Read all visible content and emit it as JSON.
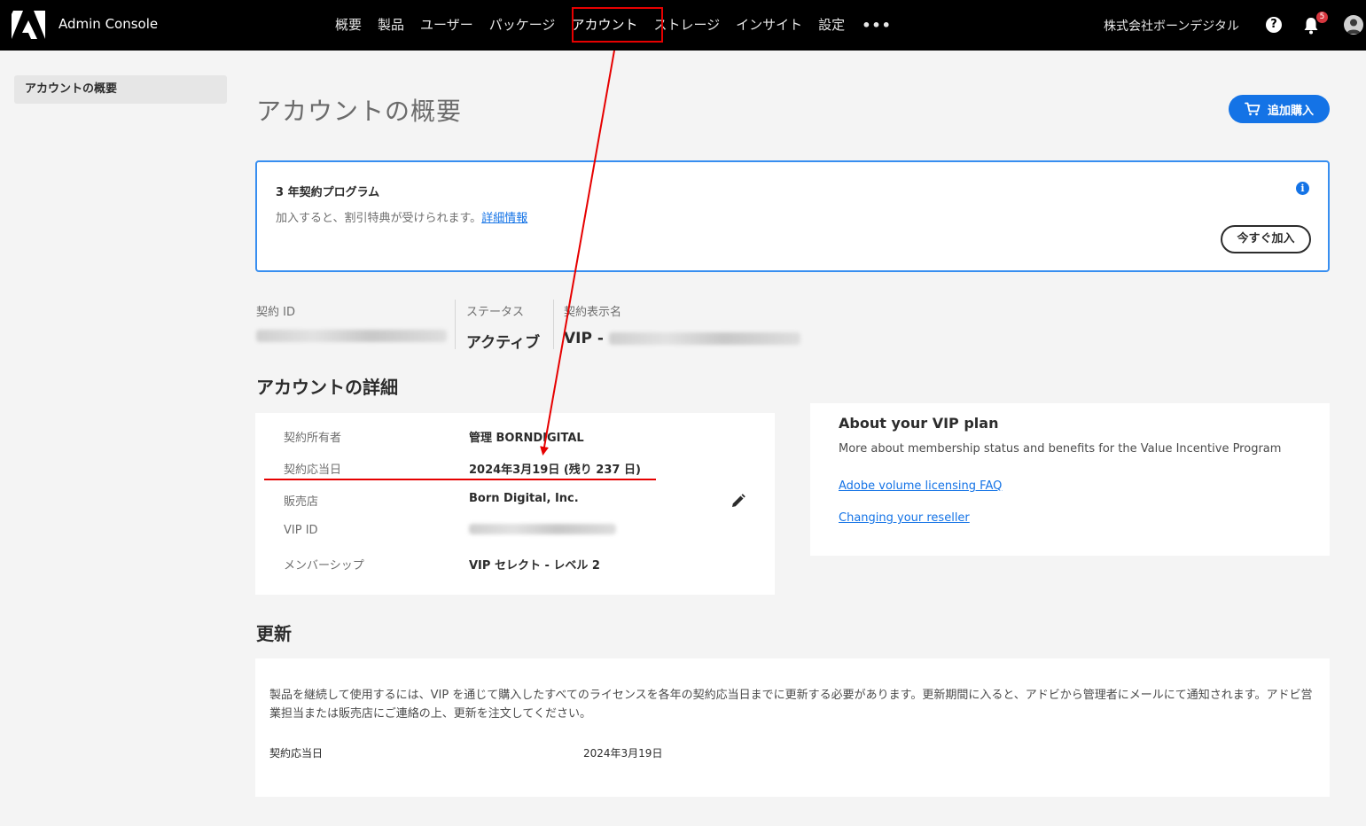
{
  "app": {
    "title": "Admin Console",
    "org_name": "株式会社ボーンデジタル",
    "notification_count": "5",
    "help_glyph": "?"
  },
  "nav": {
    "items": [
      "概要",
      "製品",
      "ユーザー",
      "パッケージ",
      "アカウント",
      "ストレージ",
      "インサイト",
      "設定"
    ],
    "active": "アカウント",
    "more": "•••"
  },
  "sidebar": {
    "items": [
      {
        "label": "アカウントの概要",
        "selected": true
      }
    ]
  },
  "page": {
    "title": "アカウントの概要",
    "buy_button": "追加購入"
  },
  "promo": {
    "title": "3 年契約プログラム",
    "description": "加入すると、割引特典が受けられます。",
    "link": "詳細情報",
    "join_button": "今すぐ加入",
    "info_glyph": "i"
  },
  "summary": {
    "contract_id_label": "契約 ID",
    "status_label": "ステータス",
    "status_value": "アクティブ",
    "display_name_label": "契約表示名",
    "display_name_prefix": "VIP -"
  },
  "details": {
    "title": "アカウントの詳細",
    "rows": [
      {
        "label": "契約所有者",
        "value": "管理 BORNDIGITAL"
      },
      {
        "label": "契約応当日",
        "value": "2024年3月19日 (残り 237 日)"
      },
      {
        "label": "販売店",
        "value": "Born Digital, Inc."
      },
      {
        "label": "VIP ID",
        "value": ""
      },
      {
        "label": "メンバーシップ",
        "value": "VIP セレクト - レベル 2"
      }
    ]
  },
  "vip": {
    "title": "About your VIP plan",
    "description": "More about membership status and benefits for the Value Incentive Program",
    "links": [
      "Adobe volume licensing FAQ",
      "Changing your reseller"
    ]
  },
  "renewal": {
    "title": "更新",
    "text": "製品を継続して使用するには、VIP を通じて購入したすべてのライセンスを各年の契約応当日までに更新する必要があります。更新期間に入ると、アドビから管理者にメールにて通知されます。アドビ営業担当または販売店にご連絡の上、更新を注文してください。",
    "date_label": "契約応当日",
    "date_value": "2024年3月19日"
  },
  "colors": {
    "accent": "#1473e6",
    "annotation": "#e60000",
    "topbar": "#000000"
  }
}
